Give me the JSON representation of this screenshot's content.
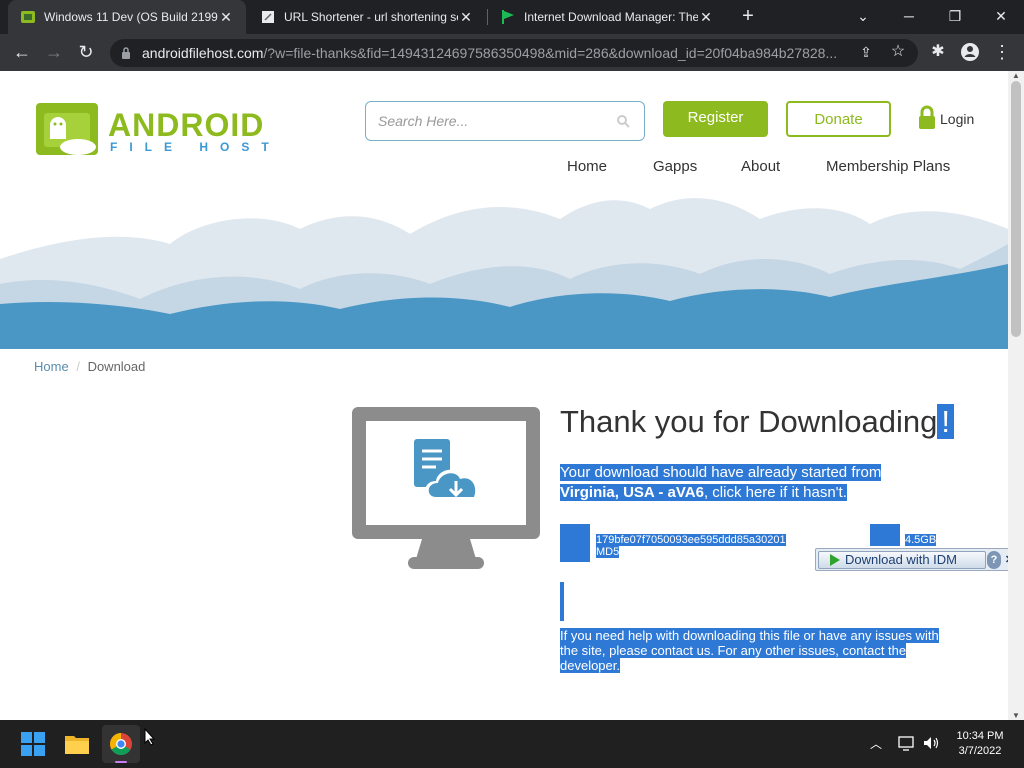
{
  "browser": {
    "tabs": [
      {
        "title": "Windows 11 Dev (OS Build 2199",
        "close": "✕",
        "icon": "android-filehost-icon"
      },
      {
        "title": "URL Shortener - url shortening se",
        "close": "✕",
        "icon": "page-icon"
      },
      {
        "title": "Internet Download Manager: The",
        "close": "✕",
        "icon": "green-flag-icon"
      }
    ],
    "new_tab": "+",
    "url_host": "androidfilehost.com",
    "url_path": "/?w=file-thanks&fid=14943124697586350498&mid=286&download_id=20f04ba984b27828..."
  },
  "site": {
    "logo_line1": "ANDROID",
    "logo_line2": "FILE HOST",
    "search_placeholder": "Search Here...",
    "register_label": "Register",
    "donate_label": "Donate",
    "login_label": "Login",
    "menu": [
      "Home",
      "Gapps",
      "About",
      "Membership Plans"
    ],
    "breadcrumb": {
      "home": "Home",
      "sep": "/",
      "current": "Download"
    }
  },
  "content": {
    "heading": "Thank you for Downloading",
    "heading_end": "!",
    "download_msg_1": "Your download should have already started from",
    "download_location": "Virginia, USA - aVA6",
    "download_msg_2": ", click here if it hasn't.",
    "md5_value": "179bfe07f7050093ee595ddd85a30201",
    "md5_label": "MD5",
    "size": "4.5GB",
    "help_text": "If you need help with downloading this file or have any issues with the site, please contact us. For any other issues, contact the developer."
  },
  "idm": {
    "label": "Download with IDM",
    "help": "?",
    "close": "✕"
  },
  "taskbar": {
    "time": "10:34 PM",
    "date": "3/7/2022"
  },
  "colors": {
    "green": "#8dba1e",
    "selection": "#2f79d6",
    "wave_blue": "#4a97c6"
  }
}
